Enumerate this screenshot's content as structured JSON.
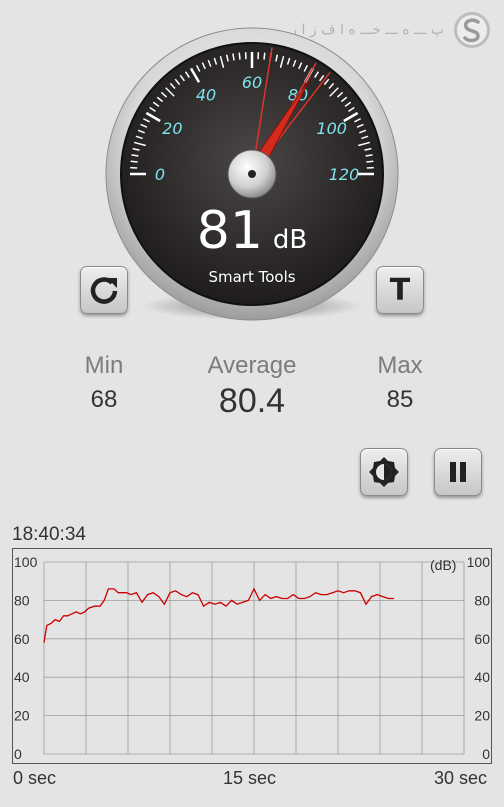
{
  "watermark": {
    "text": "پ ـــ ه ـــ خـــ ه ا ف ز ا ر",
    "icon": "s-logo-icon"
  },
  "gauge": {
    "value": 81,
    "value_text": "81",
    "unit": "dB",
    "brand": "Smart Tools",
    "min": 0,
    "max": 120,
    "ticks": [
      "0",
      "20",
      "40",
      "60",
      "80",
      "100",
      "120"
    ],
    "peak_markers": [
      66,
      80,
      85
    ]
  },
  "buttons": {
    "reset": {
      "icon": "refresh-icon"
    },
    "calibrate": {
      "label": "T"
    },
    "brightness": {
      "icon": "brightness-icon"
    },
    "pause": {
      "icon": "pause-icon"
    }
  },
  "stats": {
    "min": {
      "label": "Min",
      "value": "68"
    },
    "average": {
      "label": "Average",
      "value": "80.4"
    },
    "max": {
      "label": "Max",
      "value": "85"
    }
  },
  "graph_time": "18:40:34",
  "chart_data": {
    "type": "line",
    "unit_label": "(dB)",
    "y_ticks": [
      "100",
      "80",
      "60",
      "40",
      "20",
      "0"
    ],
    "x_labels": [
      "0 sec",
      "15 sec",
      "30 sec"
    ],
    "xlim": [
      0,
      30
    ],
    "ylim": [
      0,
      100
    ],
    "grid": true,
    "line_color": "#cc0000",
    "series": [
      {
        "x": [
          0,
          0.2,
          0.5,
          0.8,
          1.1,
          1.4,
          1.7,
          2.0,
          2.3,
          2.6,
          2.9,
          3.2,
          3.6,
          4.0,
          4.3,
          4.6,
          5.0,
          5.3,
          5.6,
          5.9,
          6.2,
          6.6,
          7.0,
          7.4,
          7.8,
          8.2,
          8.6,
          9.0,
          9.4,
          9.8,
          10.2,
          10.6,
          11.0,
          11.4,
          11.8,
          12.2,
          12.6,
          13.0,
          13.4,
          13.8,
          14.2,
          14.6,
          15.0,
          15.4,
          15.8,
          16.2,
          16.6,
          17.0,
          17.4,
          17.8,
          18.2,
          18.6,
          19.0,
          19.4,
          19.8,
          20.2,
          20.6,
          21.0,
          21.4,
          21.8,
          22.2,
          22.6,
          23.0,
          23.4,
          23.8,
          24.2,
          24.6,
          25.0
        ],
        "y": [
          58,
          67,
          68,
          70,
          69,
          72,
          72,
          73,
          74,
          73,
          74,
          76,
          77,
          77,
          80,
          86,
          86,
          84,
          84,
          84,
          83,
          84,
          79,
          83,
          84,
          82,
          78,
          84,
          85,
          83,
          82,
          84,
          83,
          77,
          79,
          78,
          79,
          77,
          80,
          78,
          79,
          80,
          86,
          80,
          83,
          81,
          82,
          81,
          81,
          83,
          81,
          81,
          82,
          84,
          83,
          83,
          84,
          85,
          84,
          85,
          85,
          84,
          78,
          82,
          83,
          82,
          81,
          81
        ]
      }
    ]
  }
}
